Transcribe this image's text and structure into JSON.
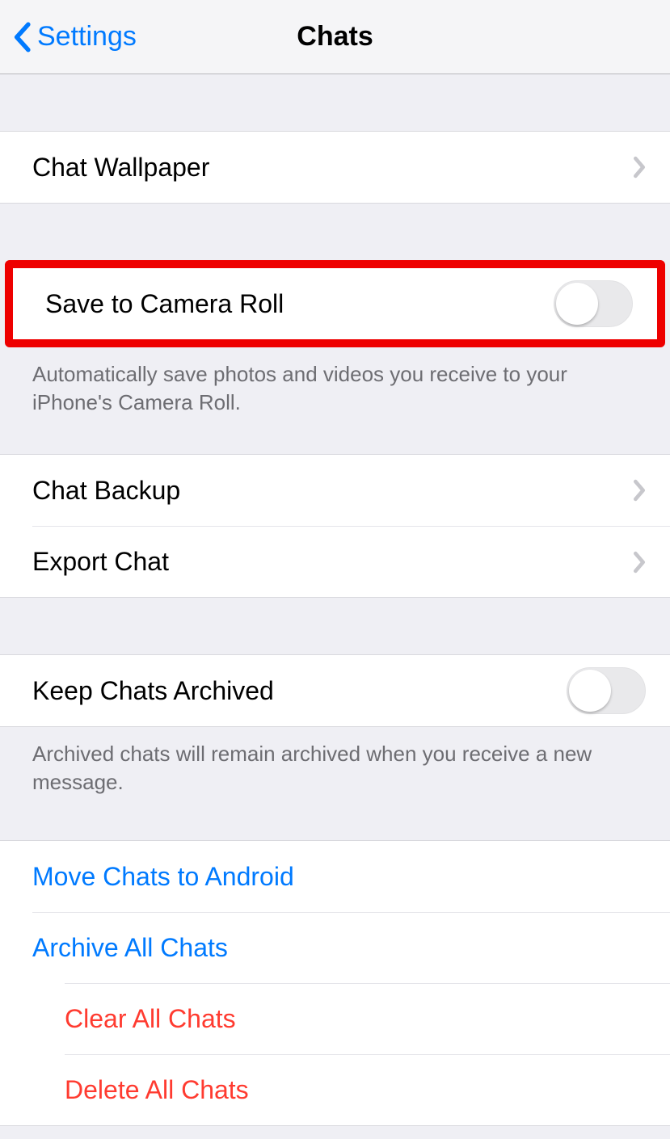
{
  "header": {
    "back_label": "Settings",
    "title": "Chats"
  },
  "rows": {
    "chat_wallpaper": "Chat Wallpaper",
    "save_camera_roll": "Save to Camera Roll",
    "save_camera_roll_footer": "Automatically save photos and videos you receive to your iPhone's Camera Roll.",
    "chat_backup": "Chat Backup",
    "export_chat": "Export Chat",
    "keep_archived": "Keep Chats Archived",
    "keep_archived_footer": "Archived chats will remain archived when you receive a new message.",
    "move_android": "Move Chats to Android",
    "archive_all": "Archive All Chats",
    "clear_all": "Clear All Chats",
    "delete_all": "Delete All Chats"
  },
  "toggles": {
    "save_camera_roll": false,
    "keep_archived": false
  },
  "colors": {
    "link_blue": "#007aff",
    "destructive_red": "#ff3b30",
    "highlight_border": "#ee0000"
  }
}
